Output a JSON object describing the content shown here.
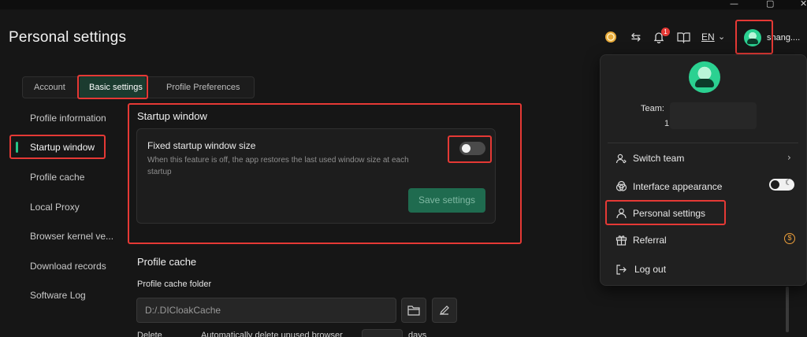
{
  "window": {
    "minimize_glyph": "—",
    "maximize_glyph": "▢",
    "close_glyph": "✕"
  },
  "header": {
    "title": "Personal settings",
    "notification_count": "1",
    "language": "EN",
    "username": "shang...."
  },
  "tabs": [
    {
      "label": "Account"
    },
    {
      "label": "Basic settings"
    },
    {
      "label": "Profile Preferences"
    }
  ],
  "sidebar": {
    "items": [
      {
        "label": "Profile information"
      },
      {
        "label": "Startup window"
      },
      {
        "label": "Profile cache"
      },
      {
        "label": "Local Proxy"
      },
      {
        "label": "Browser kernel ve..."
      },
      {
        "label": "Download records"
      },
      {
        "label": "Software Log"
      }
    ]
  },
  "startup_window": {
    "section_title": "Startup window",
    "option_title": "Fixed startup window size",
    "option_description": "When this feature is off, the app restores the last used window size at each startup",
    "toggle_on": false,
    "save_label": "Save settings"
  },
  "profile_cache": {
    "section_title": "Profile cache",
    "folder_label": "Profile cache folder",
    "folder_value": "D:/.DICloakCache",
    "delete_label": "Delete",
    "auto_delete_text": "Automatically delete unused browser",
    "days_label": "days"
  },
  "dropdown": {
    "team_label": "Team:",
    "team_value_visible": "1",
    "items": [
      {
        "label": "Switch team"
      },
      {
        "label": "Interface appearance"
      },
      {
        "label": "Personal settings"
      },
      {
        "label": "Referral"
      },
      {
        "label": "Log out"
      }
    ]
  },
  "colors": {
    "accent": "#25c487",
    "highlight": "#e53935",
    "background": "#161616"
  }
}
